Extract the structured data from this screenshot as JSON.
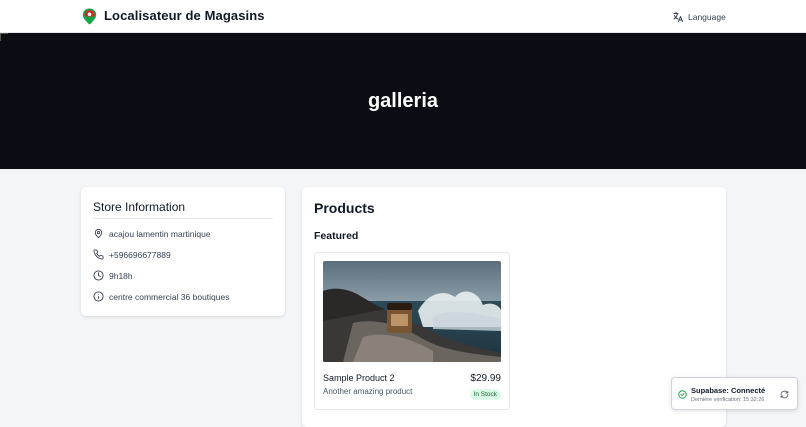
{
  "header": {
    "app_title": "Localisateur de Magasins",
    "language_label": "Language",
    "icons": {
      "logo": "map-pin-logo-icon",
      "language": "translate-icon"
    }
  },
  "hero": {
    "title": "galleria"
  },
  "store_info": {
    "title": "Store Information",
    "address": "acajou lamentin martinique",
    "phone": "+596696677889",
    "hours": "9h18h",
    "description": "centre commercial 36 boutiques",
    "icons": {
      "address": "map-pin-icon",
      "phone": "phone-icon",
      "hours": "clock-icon",
      "description": "info-icon"
    }
  },
  "products": {
    "title": "Products",
    "featured_label": "Featured",
    "items": [
      {
        "name": "Sample Product 2",
        "price": "$29.99",
        "description": "Another amazing product",
        "stock": "In Stock"
      }
    ]
  },
  "status_toast": {
    "title": "Supabase: Connecté",
    "subtitle": "Dernière vérification: 15:32:26",
    "icons": {
      "status": "check-circle-icon",
      "refresh": "refresh-icon"
    }
  },
  "colors": {
    "hero_bg": "#0a0d14",
    "stock_badge_bg": "#dcfce7",
    "stock_badge_text": "#166534",
    "logo_green": "#16a34a",
    "logo_red": "#dc2626"
  }
}
